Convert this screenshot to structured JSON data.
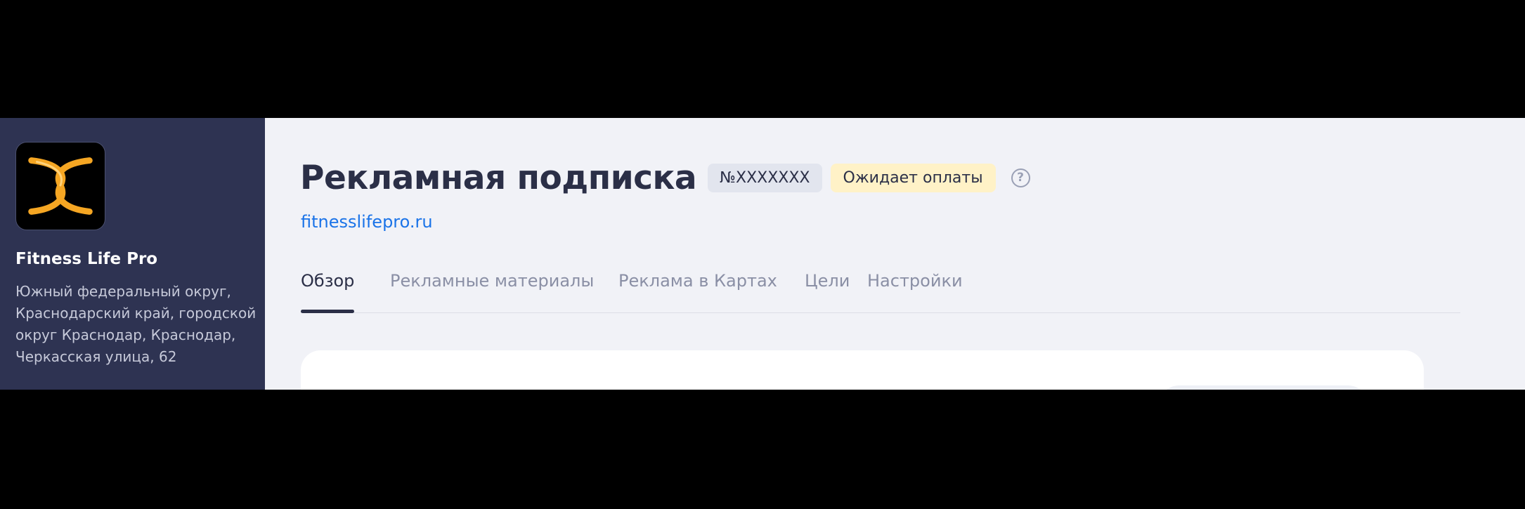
{
  "sidebar": {
    "company_name": "Fitness Life Pro",
    "address": "Южный федеральный округ, Краснодарский край, городской округ Краснодар, Краснодар, Черкасская улица, 62",
    "logo_icon": "fitness-life-pro-logo"
  },
  "header": {
    "title": "Рекламная подписка",
    "number_badge": "№XXXXXXX",
    "status": "Ожидает оплаты",
    "help_icon": "question-icon",
    "site_link": "fitnesslifepro.ru"
  },
  "tabs": [
    {
      "label": "Обзор",
      "active": true
    },
    {
      "label": "Рекламные материалы",
      "active": false
    },
    {
      "label": "Реклама в Картах",
      "active": false
    },
    {
      "label": "Цели",
      "active": false
    },
    {
      "label": "Настройки",
      "active": false
    }
  ],
  "colors": {
    "sidebar_bg": "#2e3352",
    "main_bg": "#f1f2f7",
    "status_badge_bg": "#fff2c7",
    "link": "#1a73e8",
    "logo_accent": "#f5a623"
  }
}
